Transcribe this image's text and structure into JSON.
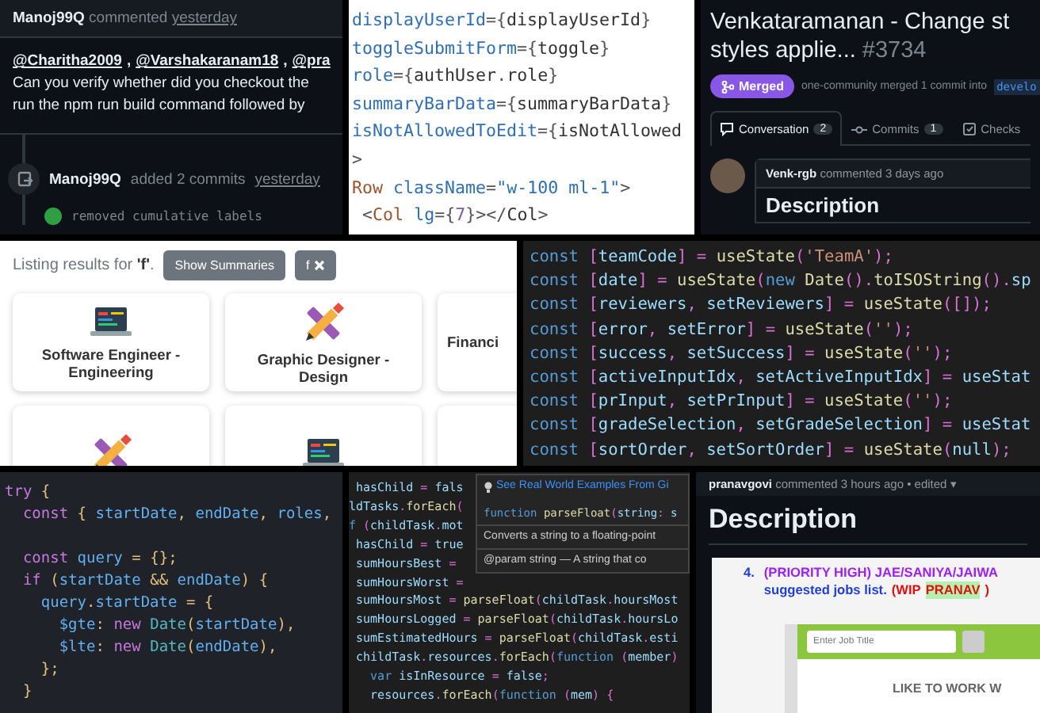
{
  "panels": [
    {
      "kind": "comment_thread",
      "comment": {
        "author": "Manoj99Q",
        "action": "commented",
        "time": "yesterday",
        "mentions": [
          {
            "text": "@Charitha2009",
            "separator": ","
          },
          {
            "text": "@Varshakaranam18",
            "separator": ","
          },
          {
            "text": "@pra"
          }
        ],
        "body": [
          "Can you verify whether did you checkout the",
          "run the npm run build command followed by"
        ]
      },
      "event": {
        "author": "Manoj99Q",
        "action": "added 2 commits",
        "time": "yesterday"
      },
      "commits": [
        {
          "message": "removed cumulative labels"
        }
      ]
    },
    {
      "kind": "code_light",
      "lines": [
        "displayUserId={displayUserId}",
        "toggleSubmitForm={toggle}",
        "role={authUser.role}",
        "summaryBarData={summaryBarData}",
        "isNotAllowedToEdit={isNotAllowed",
        ">",
        "Row className=\"w-100 ml-1\">",
        " <Col lg={7}></Col>"
      ]
    },
    {
      "kind": "pull_request",
      "title_lines": [
        "Venkataramanan - Change st",
        "styles applie..."
      ],
      "number": "#3734",
      "status": "Merged",
      "merge_text": "one-community merged 1 commit into",
      "branch": "develo",
      "tabs": [
        {
          "label": "Conversation",
          "count": "2",
          "selected": true
        },
        {
          "label": "Commits",
          "count": "1",
          "selected": false
        },
        {
          "label": "Checks",
          "selected": false
        }
      ],
      "comment": {
        "author": "Venk-rgb",
        "meta": "commented 3 days ago",
        "heading": "Description"
      }
    },
    {
      "kind": "job_listing",
      "results_text": "Listing results for **'f'**.",
      "summary_button": "Show Summaries",
      "filter_chip": "f",
      "cards": [
        {
          "title": "Software Engineer - Engineering",
          "kind": "laptop"
        },
        {
          "title": "Graphic Designer - Design",
          "kind": "design"
        },
        {
          "title": "Financi",
          "kind": "plain"
        },
        {
          "kind": "design"
        },
        {
          "kind": "laptop"
        },
        {
          "kind": "plain"
        }
      ]
    },
    {
      "kind": "code_dark",
      "lines": [
        "const [teamCode] = useState('TeamA');",
        "const [date] = useState(new Date().toISOString().sp",
        "const [reviewers, setReviewers] = useState([]);",
        "const [error, setError] = useState('');",
        "const [success, setSuccess] = useState('');",
        "const [activeInputIdx, setActiveInputIdx] = useStat",
        "const [prInput, setPrInput] = useState('');",
        "const [gradeSelection, setGradeSelection] = useStat",
        "const [sortOrder, setSortOrder] = useState(null);"
      ]
    },
    {
      "kind": "code_one_dark",
      "blocks": [
        [
          "try {",
          "  const { startDate, endDate, roles,"
        ],
        [
          "  const query = {};",
          "  if (startDate && endDate) {",
          "    query.startDate = {",
          "      $gte: new Date(startDate),",
          "      $lte: new Date(endDate),",
          "    };",
          "  }"
        ]
      ]
    },
    {
      "kind": "code_with_tooltip",
      "lines": [
        " hasChild = fals",
        "ldTasks.forEach(",
        "f (childTask.mot",
        " hasChild = true",
        " sumHoursBest =",
        " sumHoursWorst =",
        " sumHoursMost = parseFloat(childTask.hoursMost",
        " sumHoursLogged = parseFloat(childTask.hoursLo",
        " sumEstimatedHours = parseFloat(childTask.esti",
        " childTask.resources.forEach(function (member)",
        "   var isInResource = false;",
        "   resources.forEach(function (mem) {"
      ],
      "tooltip": {
        "link": "See Real World Examples From Gi",
        "signature": "function parseFloat(string: s",
        "description": "Converts a string to a floating-point",
        "param": "@param string — A string that co"
      }
    },
    {
      "kind": "issue_comment",
      "author": "pranavgovi",
      "meta": "commented 3 hours ago • edited",
      "caret": "▾",
      "heading": "Description",
      "note": {
        "number": "4.",
        "lines": [
          [
            {
              "text": "(PRIORITY HIGH) JAE/SANIYA/JAIWA",
              "color": "#a020f0",
              "highlighted": false
            }
          ],
          [
            {
              "text": "suggested jobs list.",
              "color": "#1f3fd6",
              "highlighted": false
            },
            {
              "text": "(WIP",
              "color": "#e01010",
              "highlighted": false
            },
            {
              "text": "PRANAV",
              "color": "#e01010",
              "highlighted": true
            },
            {
              "text": ")",
              "color": "#e01010",
              "highlighted": false
            }
          ]
        ]
      },
      "job_search": {
        "placeholder": "Enter Job Title",
        "banner": "LIKE TO WORK W"
      }
    }
  ]
}
